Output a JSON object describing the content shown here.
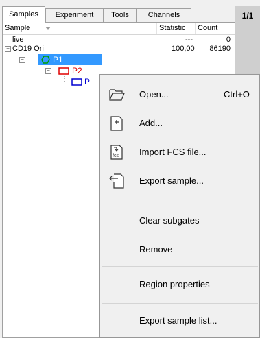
{
  "tabs": {
    "samples": "Samples",
    "experiment": "Experiment",
    "tools": "Tools",
    "channels": "Channels",
    "page_counter": "1/1"
  },
  "grid": {
    "col_sample": "Sample",
    "col_statistic": "Statistic",
    "col_count": "Count"
  },
  "rows": {
    "live": {
      "name": "live",
      "statistic": "---",
      "count": "0"
    },
    "cd19": {
      "name": "CD19 Ori",
      "statistic": "100,00",
      "count": "86190"
    },
    "p1": {
      "name": "P1"
    },
    "p2": {
      "name": "P2"
    },
    "p3": {
      "name": "P"
    }
  },
  "colors": {
    "selection": "#3399ff",
    "gate_green": "#00a000",
    "gate_red": "#e00000",
    "gate_blue": "#0000d0"
  },
  "menu": {
    "open": "Open...",
    "open_shortcut": "Ctrl+O",
    "add": "Add...",
    "import_fcs": "Import FCS file...",
    "export_sample": "Export sample...",
    "clear_subgates": "Clear subgates",
    "remove": "Remove",
    "region_properties": "Region properties",
    "export_sample_list": "Export sample list..."
  },
  "icons": {
    "open": "folder-open-icon",
    "add": "add-document-icon",
    "import": "import-fcs-icon",
    "export": "export-document-icon",
    "fcs_label": "fcs"
  }
}
